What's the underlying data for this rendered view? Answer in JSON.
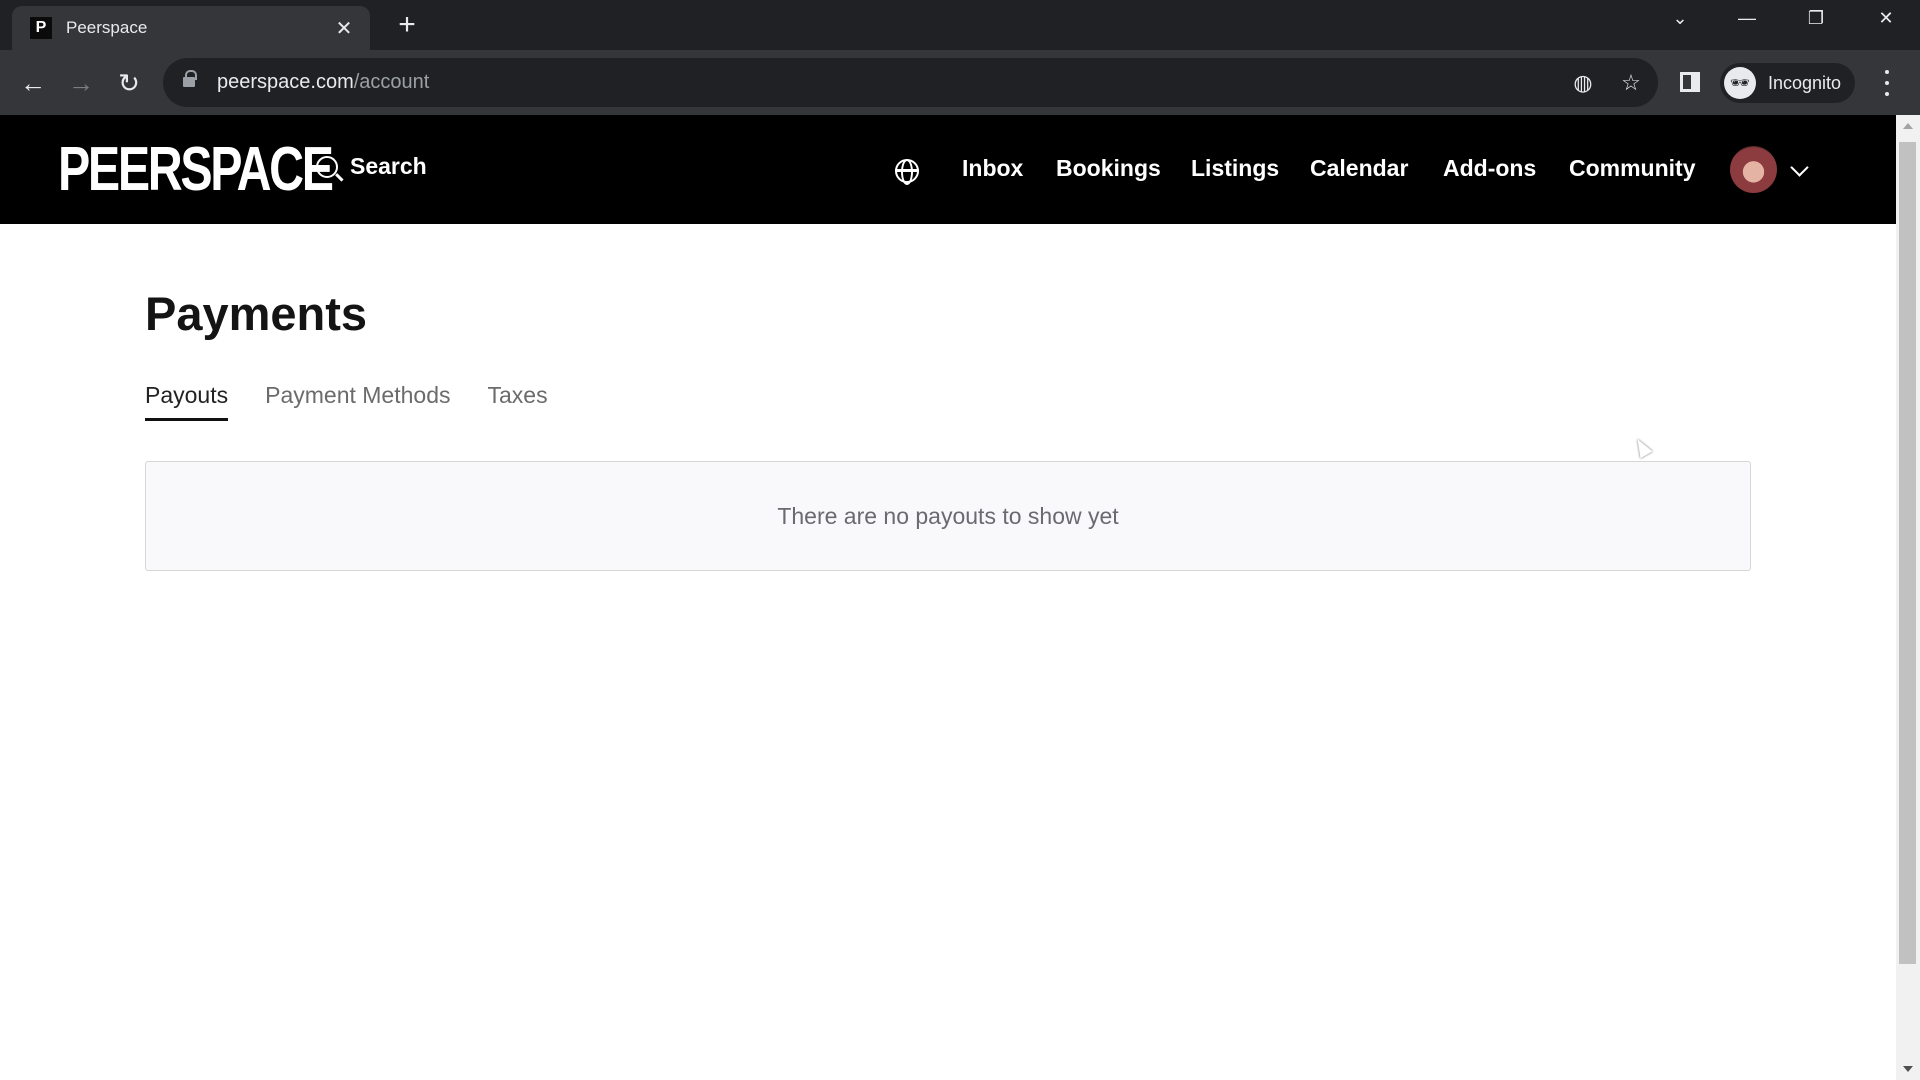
{
  "browser": {
    "tab": {
      "favicon_letter": "P",
      "title": "Peerspace",
      "close_glyph": "✕"
    },
    "new_tab_glyph": "+",
    "window_controls": {
      "tab_search": "⌄",
      "minimize": "—",
      "restore": "❐",
      "close": "✕"
    },
    "nav": {
      "back": "←",
      "forward": "→",
      "reload": "↻"
    },
    "address": {
      "host": "peerspace.com",
      "path": "/account"
    },
    "omnibox_icons": {
      "tracking": "◍",
      "bookmark": "☆"
    },
    "profile": {
      "icon": "🕶",
      "label": "Incognito"
    }
  },
  "header": {
    "logo": "PEERSPACE",
    "search_label": "Search",
    "nav_items": [
      {
        "label": "Inbox"
      },
      {
        "label": "Bookings"
      },
      {
        "label": "Listings"
      },
      {
        "label": "Calendar"
      },
      {
        "label": "Add-ons"
      },
      {
        "label": "Community"
      }
    ]
  },
  "main": {
    "title": "Payments",
    "tabs": [
      {
        "label": "Payouts",
        "active": true
      },
      {
        "label": "Payment Methods",
        "active": false
      },
      {
        "label": "Taxes",
        "active": false
      }
    ],
    "empty_state": "There are no payouts to show yet"
  }
}
